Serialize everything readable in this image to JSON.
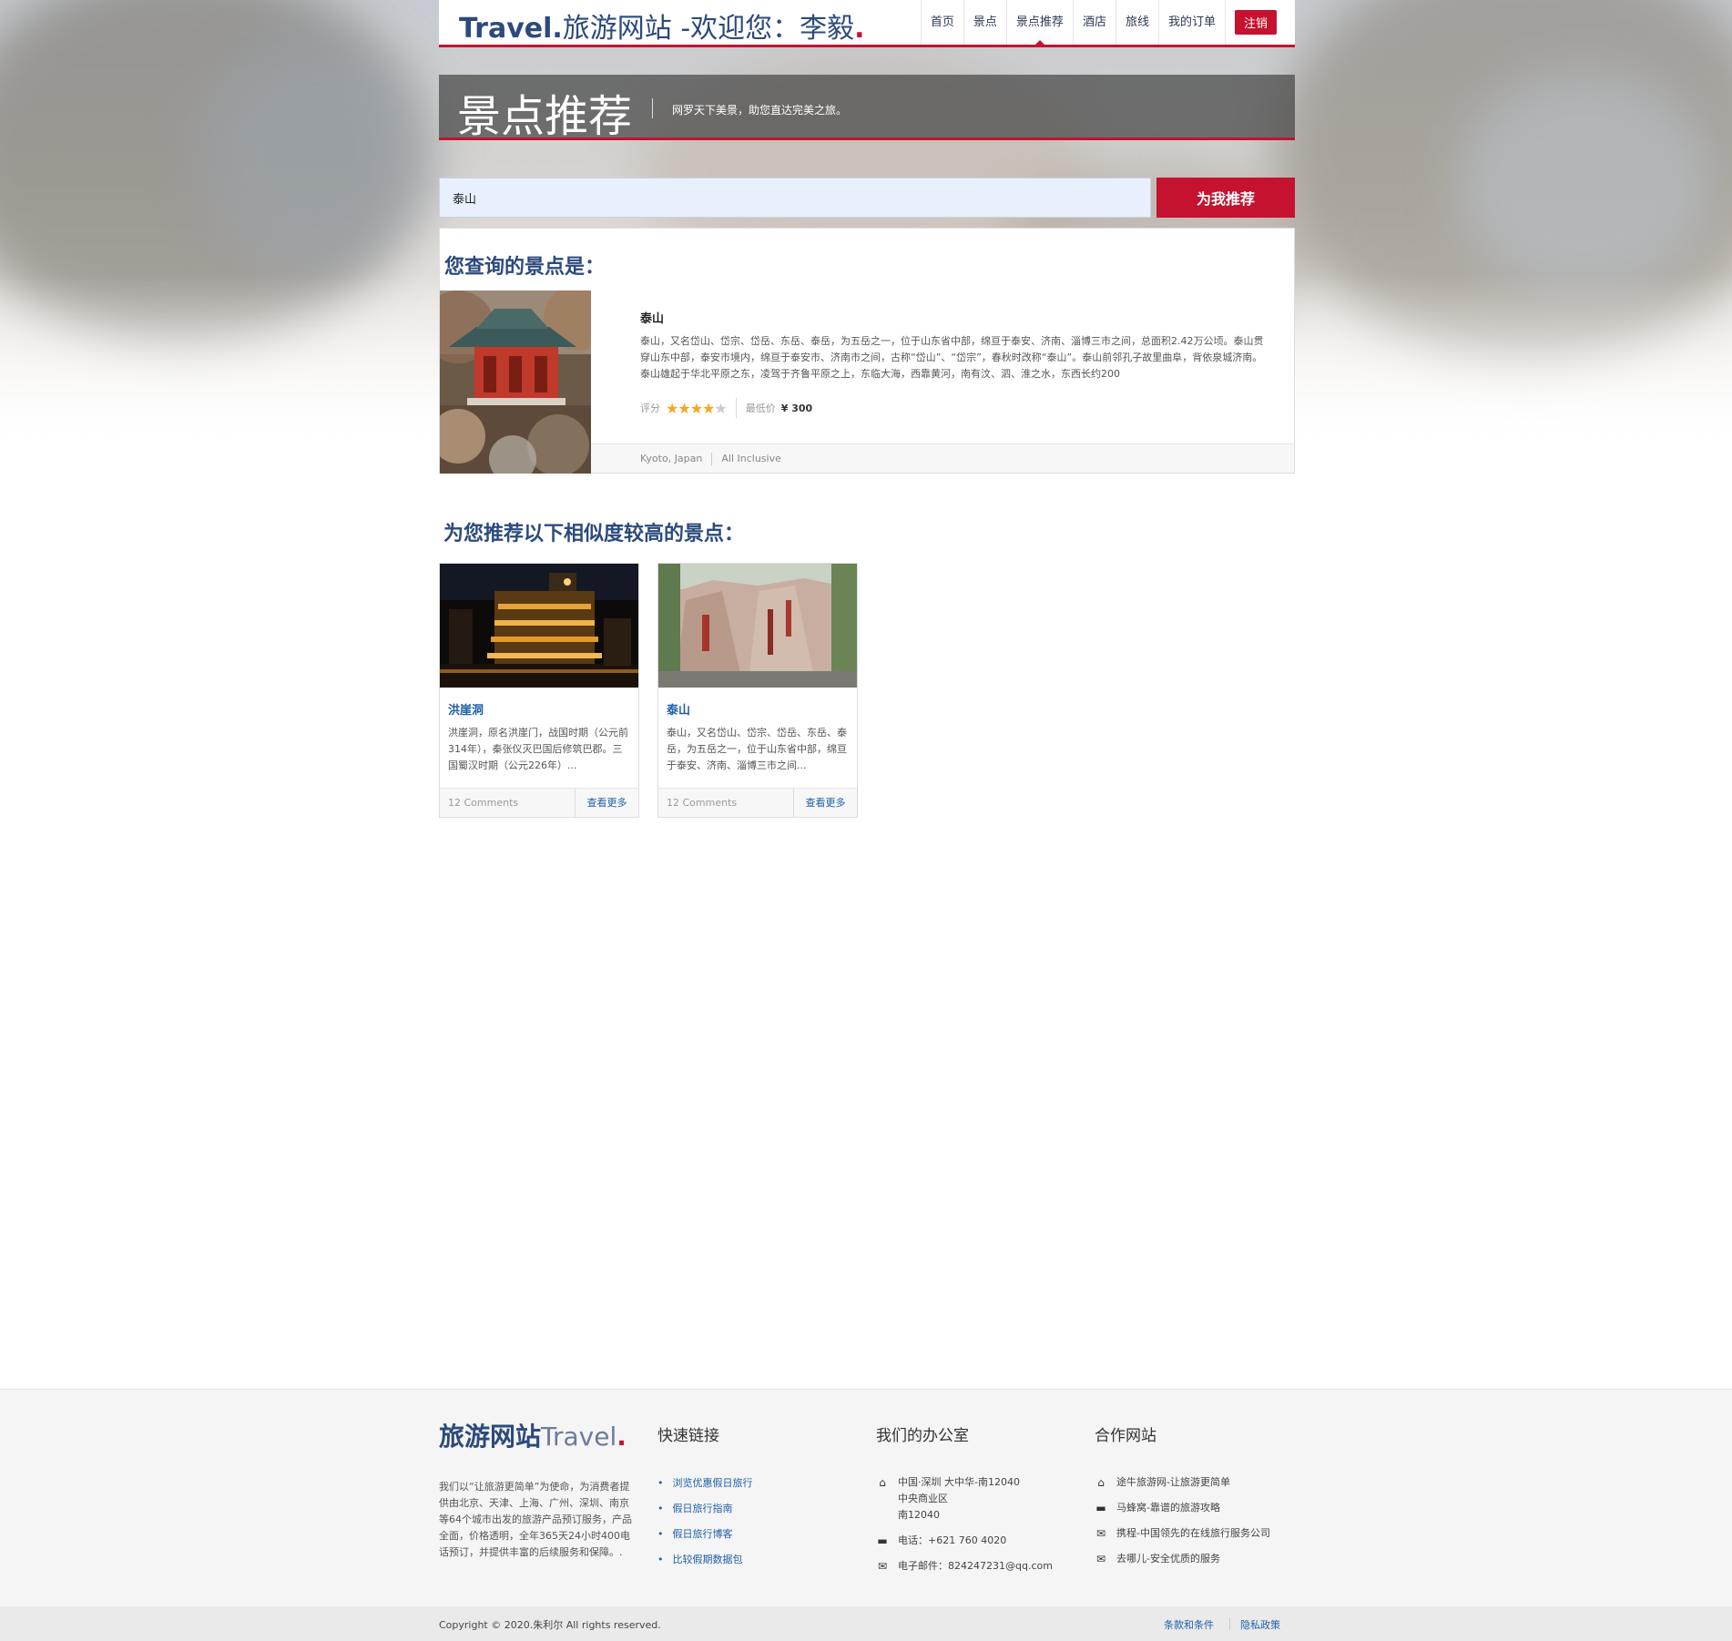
{
  "header": {
    "brand_bold": "Travel.",
    "brand_text": "旅游网站 -欢迎您：李毅",
    "brand_dot": ".",
    "nav": [
      {
        "label": "首页"
      },
      {
        "label": "景点"
      },
      {
        "label": "景点推荐",
        "active": true
      },
      {
        "label": "酒店"
      },
      {
        "label": "旅线"
      },
      {
        "label": "我的订单"
      }
    ],
    "logout_label": "注销"
  },
  "banner": {
    "title": "景点推荐",
    "subtitle": "网罗天下美景，助您直达完美之旅。"
  },
  "search": {
    "value": "泰山",
    "button_label": "为我推荐"
  },
  "result": {
    "heading": "您查询的景点是：",
    "name": "泰山",
    "description": "泰山，又名岱山、岱宗、岱岳、东岳、泰岳，为五岳之一，位于山东省中部，绵亘于泰安、济南、淄博三市之间，总面积2.42万公顷。泰山贯穿山东中部，泰安市境内，绵亘于泰安市、济南市之间，古称“岱山”、“岱宗”，春秋时改称“泰山”。泰山前邻孔子故里曲阜，背依泉城济南。泰山雄起于华北平原之东，凌驾于齐鲁平原之上，东临大海，西靠黄河，南有汶、泗、淮之水，东西长约200",
    "rating_label": "评分",
    "rating": 4,
    "rating_max": 5,
    "price_label": "最低价",
    "price": "¥ 300",
    "location": "Kyoto, Japan",
    "package": "All Inclusive"
  },
  "recommendations": {
    "heading": "为您推荐以下相似度较高的景点：",
    "items": [
      {
        "name": "洪崖洞",
        "description": "洪崖洞，原名洪崖门，战国时期（公元前314年），秦张仪灭巴国后修筑巴郡。三国蜀汉时期（公元226年）...",
        "comments": "12 Comments",
        "more_label": "查看更多"
      },
      {
        "name": "泰山",
        "description": "泰山，又名岱山、岱宗、岱岳、东岳、泰岳，为五岳之一，位于山东省中部，绵亘于泰安、济南、淄博三市之间...",
        "comments": "12 Comments",
        "more_label": "查看更多"
      }
    ]
  },
  "footer": {
    "brand_bold": "旅游网站",
    "brand_light": "Travel",
    "brand_dot": ".",
    "description": "我们以“让旅游更简单”为使命，为消费者提供由北京、天津、上海、广州、深圳、南京等64个城市出发的旅游产品预订服务，产品全面，价格透明，全年365天24小时400电话预订，并提供丰富的后续服务和保障。.",
    "quick_links": {
      "heading": "快速链接",
      "items": [
        "浏览优惠假日旅行",
        "假日旅行指南",
        "假日旅行博客",
        "比较假期数据包"
      ]
    },
    "office": {
      "heading": "我们的办公室",
      "address_lines": [
        "中国·深圳 大中华-南12040",
        "中央商业区",
        "南12040"
      ],
      "phone": "电话：+621 760 4020",
      "email": "电子邮件：824247231@qq.com"
    },
    "partners": {
      "heading": "合作网站",
      "items": [
        "途牛旅游网-让旅游更简单",
        "马蜂窝-靠谱的旅游攻略",
        "携程-中国领先的在线旅行服务公司",
        "去哪儿-安全优质的服务"
      ]
    },
    "copyright": "Copyright © 2020.朱利尔 All rights reserved.",
    "terms": "条款和条件",
    "privacy": "隐私政策"
  },
  "colors": {
    "accent": "#c4122f",
    "brand_blue": "#2c4a7c",
    "link_blue": "#1f5fa8"
  }
}
